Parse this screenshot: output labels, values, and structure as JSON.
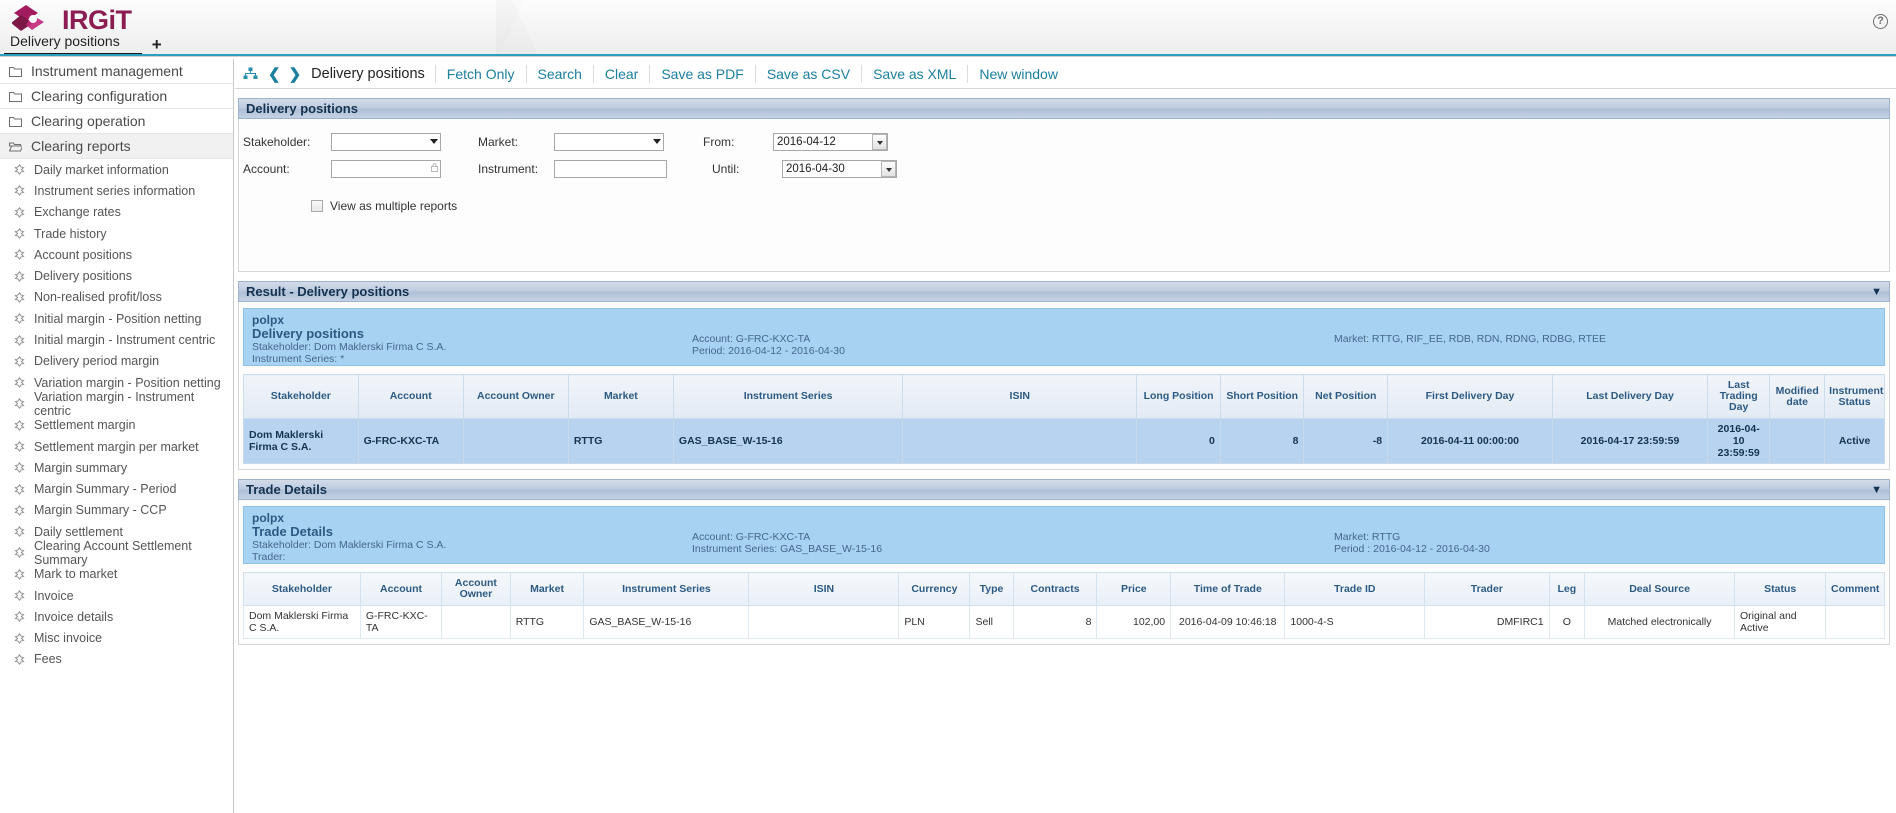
{
  "app": {
    "brand": "IRGiT",
    "help_icon": "help-circle-icon"
  },
  "tabs": {
    "items": [
      {
        "label": "Delivery positions",
        "active": true
      }
    ],
    "add_label": "+"
  },
  "sidebar": {
    "groups": [
      {
        "label": "Instrument management",
        "icon": "folder-icon",
        "open": false
      },
      {
        "label": "Clearing configuration",
        "icon": "folder-icon",
        "open": false
      },
      {
        "label": "Clearing operation",
        "icon": "folder-icon",
        "open": false
      },
      {
        "label": "Clearing reports",
        "icon": "folder-open-icon",
        "open": true
      }
    ],
    "items": [
      {
        "label": "Daily market information"
      },
      {
        "label": "Instrument series information"
      },
      {
        "label": "Exchange rates"
      },
      {
        "label": "Trade history"
      },
      {
        "label": "Account positions"
      },
      {
        "label": "Delivery positions"
      },
      {
        "label": "Non-realised profit/loss"
      },
      {
        "label": "Initial margin - Position netting"
      },
      {
        "label": "Initial margin - Instrument centric"
      },
      {
        "label": "Delivery period margin"
      },
      {
        "label": "Variation margin - Position netting"
      },
      {
        "label": "Variation margin - Instrument centric"
      },
      {
        "label": "Settlement margin"
      },
      {
        "label": "Settlement margin per market"
      },
      {
        "label": "Margin summary"
      },
      {
        "label": "Margin Summary - Period"
      },
      {
        "label": "Margin Summary - CCP"
      },
      {
        "label": "Daily settlement"
      },
      {
        "label": "Clearing Account Settlement Summary"
      },
      {
        "label": "Mark to market"
      },
      {
        "label": "Invoice"
      },
      {
        "label": "Invoice details"
      },
      {
        "label": "Misc invoice"
      },
      {
        "label": "Fees"
      }
    ]
  },
  "command_bar": {
    "hierarchy_icon": "sitemap-icon",
    "prev_icon": "chevron-left-icon",
    "next_icon": "chevron-right-icon",
    "title": "Delivery positions",
    "links": [
      {
        "label": "Fetch Only"
      },
      {
        "label": "Search"
      },
      {
        "label": "Clear"
      },
      {
        "label": "Save as PDF"
      },
      {
        "label": "Save as CSV"
      },
      {
        "label": "Save as XML"
      },
      {
        "label": "New window"
      }
    ]
  },
  "search_panel": {
    "title": "Delivery positions",
    "collapse_icon": "collapse-icon",
    "fields": {
      "stakeholder_label": "Stakeholder:",
      "stakeholder_value": "",
      "market_label": "Market:",
      "market_value": "",
      "from_label": "From:",
      "from_value": "2016-04-12",
      "account_label": "Account:",
      "account_value": "",
      "instrument_label": "Instrument:",
      "instrument_value": "",
      "until_label": "Until:",
      "until_value": "2016-04-30"
    },
    "multiple_reports_label": "View as multiple reports",
    "multiple_reports_checked": false
  },
  "result_panel": {
    "title": "Result - Delivery positions",
    "collapse_icon": "collapse-icon",
    "report_header": {
      "org": "polpx",
      "title": "Delivery positions",
      "stakeholder": "Stakeholder: Dom Maklerski Firma C S.A.",
      "instrument_series": "Instrument Series: *",
      "account": "Account: G-FRC-KXC-TA",
      "period": "Period: 2016-04-12 - 2016-04-30",
      "market": "Market: RTTG, RIF_EE, RDB, RDN, RDNG, RDBG, RTEE"
    },
    "columns": [
      "Stakeholder",
      "Account",
      "Account Owner",
      "Market",
      "Instrument Series",
      "ISIN",
      "Long Position",
      "Short Position",
      "Net Position",
      "First Delivery Day",
      "Last Delivery Day",
      "Last Trading Day",
      "Modified date",
      "Instrument Status"
    ],
    "rows": [
      {
        "stakeholder": "Dom Maklerski Firma C S.A.",
        "account": "G-FRC-KXC-TA",
        "account_owner": "",
        "market": "RTTG",
        "instrument_series": "GAS_BASE_W-15-16",
        "isin": "",
        "long_position": "0",
        "short_position": "8",
        "net_position": "-8",
        "first_delivery_day": "2016-04-11 00:00:00",
        "last_delivery_day": "2016-04-17 23:59:59",
        "last_trading_day": "2016-04-10 23:59:59",
        "modified_date": "",
        "instrument_status": "Active"
      }
    ]
  },
  "trade_panel": {
    "title": "Trade Details",
    "collapse_icon": "collapse-icon",
    "report_header": {
      "org": "polpx",
      "title": "Trade Details",
      "stakeholder": "Stakeholder: Dom Maklerski Firma C S.A.",
      "trader": "Trader:",
      "account": "Account: G-FRC-KXC-TA",
      "instrument_series": "Instrument Series: GAS_BASE_W-15-16",
      "market": "Market: RTTG",
      "period": "Period : 2016-04-12 - 2016-04-30"
    },
    "columns": [
      "Stakeholder",
      "Account",
      "Account Owner",
      "Market",
      "Instrument Series",
      "ISIN",
      "Currency",
      "Type",
      "Contracts",
      "Price",
      "Time of Trade",
      "Trade ID",
      "Trader",
      "Leg",
      "Deal Source",
      "Status",
      "Comment"
    ],
    "rows": [
      {
        "stakeholder": "Dom Maklerski Firma C S.A.",
        "account": "G-FRC-KXC-TA",
        "account_owner": "",
        "market": "RTTG",
        "instrument_series": "GAS_BASE_W-15-16",
        "isin": "",
        "currency": "PLN",
        "type": "Sell",
        "contracts": "8",
        "price": "102,00",
        "time_of_trade": "2016-04-09 10:46:18",
        "trade_id": "1000-4-S",
        "trader": "DMFIRC1",
        "leg": "O",
        "deal_source": "Matched electronically",
        "status": "Original and Active",
        "comment": ""
      }
    ]
  },
  "colors": {
    "brand_magenta": "#8c1d52",
    "link_teal": "#1c7f9e",
    "panel_header": "#aebfd6",
    "report_band": "#a7d2f2",
    "result_row": "#b7d3ef",
    "tab_underline": "#2a9fc0"
  }
}
